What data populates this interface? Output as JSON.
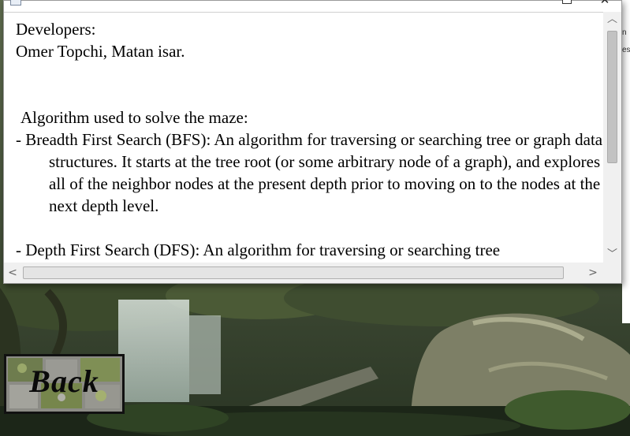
{
  "window": {
    "content": {
      "developers_heading": "Developers:",
      "developers_names": "Omer Topchi, Matan isar.",
      "algorithm_heading": "Algorithm used to solve the maze:",
      "bfs_text": "- Breadth First Search (BFS):  An algorithm for traversing or searching tree or graph data structures. It starts at the tree root (or some arbitrary node of a graph), and explores all of the neighbor nodes at the present depth prior to moving on to the nodes at the next depth level.",
      "dfs_text": "- Depth First Search (DFS): An algorithm for traversing or searching tree"
    },
    "controls": {
      "close_glyph": "✕",
      "scroll_up_glyph": "︿",
      "scroll_down_glyph": "﹀",
      "scroll_left_glyph": "<",
      "scroll_right_glyph": ">"
    }
  },
  "back_button": {
    "label": "Back"
  },
  "edge_strip": {
    "text_top": "n",
    "text_mid": "es"
  },
  "icons": {
    "app": "app-icon",
    "maximize": "maximize-icon",
    "close": "close-icon"
  },
  "colors": {
    "window_bg": "#ffffff",
    "scrollbar_bg": "#f0f0f0",
    "scene_dark": "#1a2418",
    "button_border": "#111111"
  }
}
